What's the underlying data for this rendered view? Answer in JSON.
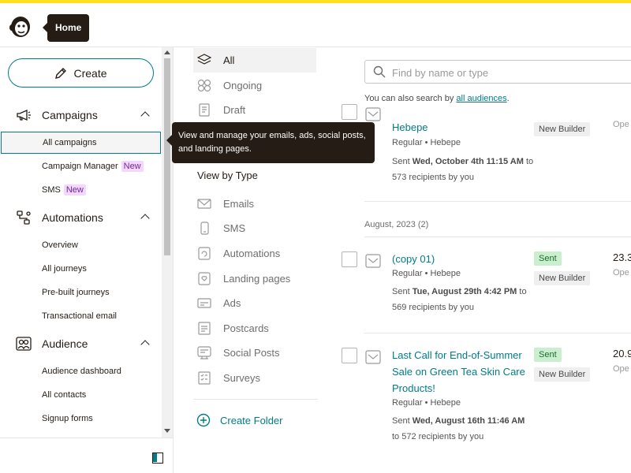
{
  "topbar": {
    "home_tooltip": "Home"
  },
  "sidebar": {
    "create_label": "Create",
    "sections": [
      {
        "label": "Campaigns",
        "items": [
          {
            "label": "All campaigns",
            "active": true
          },
          {
            "label": "Campaign Manager",
            "badge": "New"
          },
          {
            "label": "SMS",
            "badge": "New"
          }
        ]
      },
      {
        "label": "Automations",
        "items": [
          {
            "label": "Overview"
          },
          {
            "label": "All journeys"
          },
          {
            "label": "Pre-built journeys"
          },
          {
            "label": "Transactional email"
          }
        ]
      },
      {
        "label": "Audience",
        "items": [
          {
            "label": "Audience dashboard"
          },
          {
            "label": "All contacts"
          },
          {
            "label": "Signup forms"
          }
        ]
      }
    ]
  },
  "tooltip": "View and manage your emails, ads, social posts, and landing pages.",
  "filters": {
    "status": [
      "All",
      "Ongoing",
      "Draft"
    ],
    "view_by_type": "View by Type",
    "types": [
      "Emails",
      "SMS",
      "Automations",
      "Landing pages",
      "Ads",
      "Postcards",
      "Social Posts",
      "Surveys"
    ],
    "create_folder": "Create Folder"
  },
  "search": {
    "placeholder": "Find by name or type",
    "hint_prefix": "You can also search by",
    "hint_link": "all audiences",
    "hint_suffix": "."
  },
  "campaigns": [
    {
      "title": "Hebepe",
      "meta": "Regular • Hebepe",
      "sent_prefix": "Sent",
      "sent_date": "Wed, October 4th 11:15 AM",
      "sent_suffix": "to 573 recipients by you",
      "tags": [
        "New Builder"
      ],
      "stat_label": "Ope"
    },
    {
      "month": "August, 2023 (2)",
      "title": "(copy 01)",
      "meta": "Regular • Hebepe",
      "sent_prefix": "Sent",
      "sent_date": "Tue, August 29th 4:42 PM",
      "sent_suffix": "to 569 recipients by you",
      "tags": [
        "Sent",
        "New Builder"
      ],
      "stat_num": "23.3",
      "stat_label": "Ope"
    },
    {
      "title": "Last Call for End-of-Summer Sale on Green Tea Skin Care Products!",
      "meta": "Regular • Hebepe",
      "sent_prefix": "Sent",
      "sent_date": "Wed, August 16th 11:46 AM",
      "sent_suffix": "to 572 recipients by you",
      "tags": [
        "Sent",
        "New Builder"
      ],
      "stat_num": "20.9",
      "stat_label": "Ope"
    }
  ],
  "colors": {
    "accent": "#007c89",
    "brand_yellow": "#ffe01b",
    "sent_tag": "#c9efcf",
    "new_badge": "#f4d7ff"
  }
}
